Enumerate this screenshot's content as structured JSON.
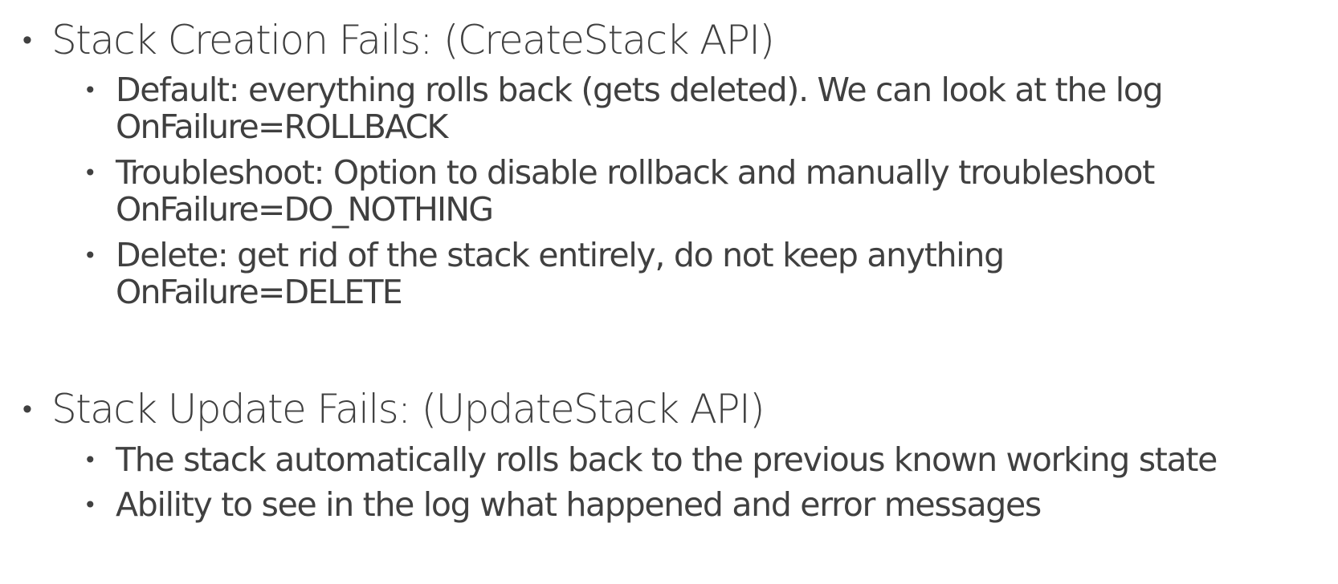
{
  "sections": [
    {
      "heading": "Stack Creation Fails: (CreateStack API)",
      "items": [
        {
          "text": "Default: everything rolls back (gets deleted). We can look at the log",
          "code": "OnFailure=ROLLBACK"
        },
        {
          "text": "Troubleshoot: Option to disable rollback and manually troubleshoot",
          "code": "OnFailure=DO_NOTHING"
        },
        {
          "text": "Delete: get rid of the stack entirely, do not keep anything",
          "code": "OnFailure=DELETE"
        }
      ]
    },
    {
      "heading": "Stack Update Fails: (UpdateStack API)",
      "items": [
        {
          "text": "The stack automatically rolls back to the previous known working state"
        },
        {
          "text": "Ability to see in the log what happened and error messages"
        }
      ]
    }
  ],
  "bullet_glyph": "•"
}
